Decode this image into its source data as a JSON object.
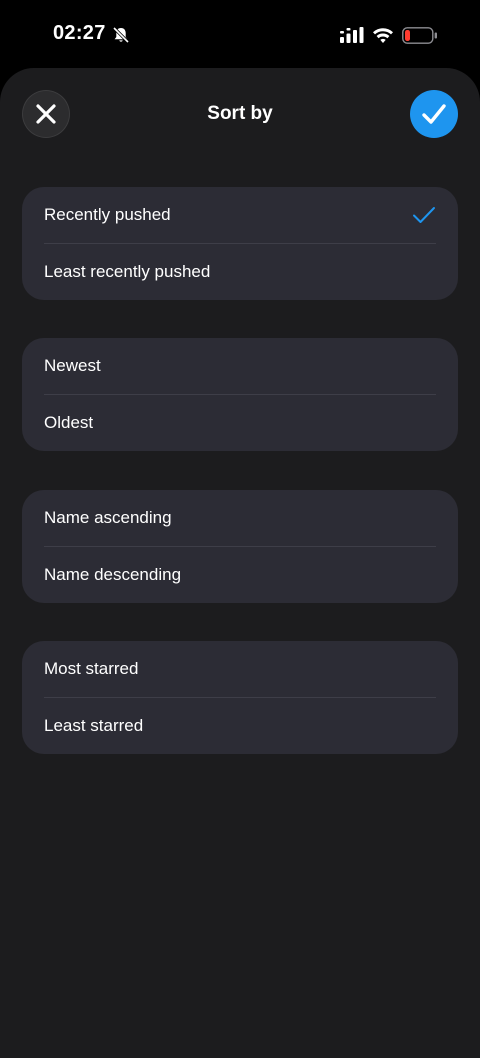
{
  "status_bar": {
    "time": "02:27",
    "icons": [
      "bell-slash-icon",
      "signal-icon",
      "wifi-icon",
      "battery-low-icon"
    ],
    "battery_color": "#ff3b30"
  },
  "header": {
    "title": "Sort by",
    "close_icon": "close-icon",
    "confirm_icon": "checkmark-icon"
  },
  "colors": {
    "accent": "#1e95ef",
    "sheet_background": "#1c1c1e",
    "group_background": "#2c2c35"
  },
  "groups": [
    {
      "options": [
        {
          "label": "Recently pushed",
          "selected": true
        },
        {
          "label": "Least recently pushed",
          "selected": false
        }
      ]
    },
    {
      "options": [
        {
          "label": "Newest",
          "selected": false
        },
        {
          "label": "Oldest",
          "selected": false
        }
      ]
    },
    {
      "options": [
        {
          "label": "Name ascending",
          "selected": false
        },
        {
          "label": "Name descending",
          "selected": false
        }
      ]
    },
    {
      "options": [
        {
          "label": "Most starred",
          "selected": false
        },
        {
          "label": "Least starred",
          "selected": false
        }
      ]
    }
  ]
}
